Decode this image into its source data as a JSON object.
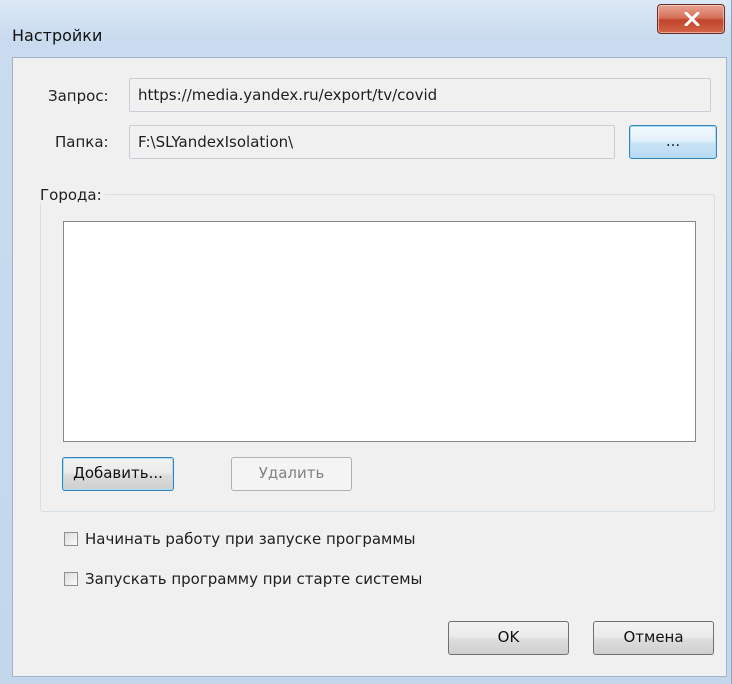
{
  "window": {
    "title": "Настройки"
  },
  "form": {
    "query_label": "Запрос:",
    "query_value": "https://media.yandex.ru/export/tv/covid",
    "folder_label": "Папка:",
    "folder_value": "F:\\SLYandexIsolation\\",
    "browse_label": "..."
  },
  "cities": {
    "group_title": "Города:",
    "items": [],
    "add_label": "Добавить...",
    "delete_label": "Удалить"
  },
  "options": {
    "start_on_launch_label": "Начинать работу при запуске программы",
    "start_on_launch_checked": false,
    "run_on_startup_label": "Запускать программу при старте системы",
    "run_on_startup_checked": false
  },
  "footer": {
    "ok_label": "OK",
    "cancel_label": "Отмена"
  },
  "icons": {
    "close": "close-icon"
  },
  "colors": {
    "close_button": "#c7503a",
    "focus_border": "#3c7fb1"
  }
}
